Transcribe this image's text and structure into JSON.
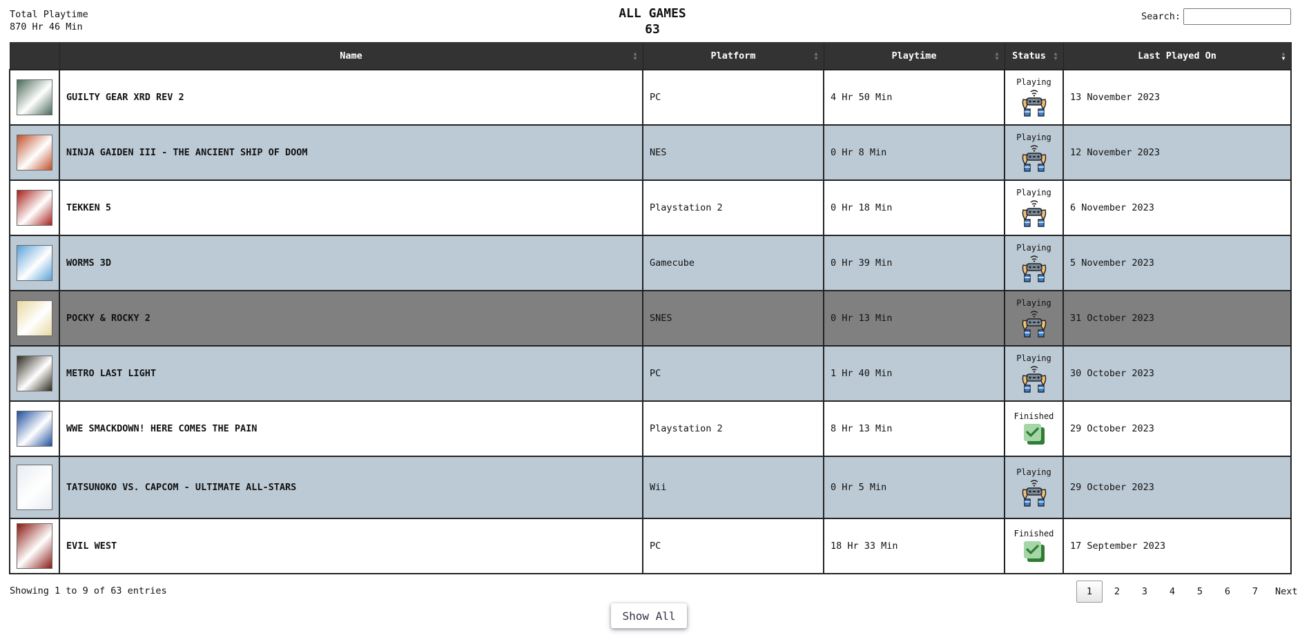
{
  "header": {
    "total_playtime_label": "Total Playtime",
    "total_playtime_value": "870 Hr 46 Min",
    "title": "ALL GAMES",
    "count": "63",
    "search_label": "Search:",
    "search_value": ""
  },
  "table": {
    "columns": [
      "Name",
      "Platform",
      "Playtime",
      "Status",
      "Last Played On"
    ],
    "rows": [
      {
        "name": "GUILTY GEAR XRD REV 2",
        "platform": "PC",
        "playtime": "4 Hr 50 Min",
        "status": "Playing",
        "last_played": "13 November 2023",
        "cover": "#4a6a5a"
      },
      {
        "name": "NINJA GAIDEN III - THE ANCIENT SHIP OF DOOM",
        "platform": "NES",
        "playtime": "0 Hr 8 Min",
        "status": "Playing",
        "last_played": "12 November 2023",
        "cover": "#c0502a"
      },
      {
        "name": "TEKKEN 5",
        "platform": "Playstation 2",
        "playtime": "0 Hr 18 Min",
        "status": "Playing",
        "last_played": "6 November 2023",
        "cover": "#a8201c"
      },
      {
        "name": "WORMS 3D",
        "platform": "Gamecube",
        "playtime": "0 Hr 39 Min",
        "status": "Playing",
        "last_played": "5 November 2023",
        "cover": "#5aa2d8"
      },
      {
        "name": "POCKY & ROCKY 2",
        "platform": "SNES",
        "playtime": "0 Hr 13 Min",
        "status": "Playing",
        "last_played": "31 October 2023",
        "cover": "#e8d8a0"
      },
      {
        "name": "METRO LAST LIGHT",
        "platform": "PC",
        "playtime": "1 Hr 40 Min",
        "status": "Playing",
        "last_played": "30 October 2023",
        "cover": "#2e2a1e"
      },
      {
        "name": "WWE SMACKDOWN! HERE COMES THE PAIN",
        "platform": "Playstation 2",
        "playtime": "8 Hr 13 Min",
        "status": "Finished",
        "last_played": "29 October 2023",
        "cover": "#1f4f9e"
      },
      {
        "name": "TATSUNOKO VS. CAPCOM - ULTIMATE ALL-STARS",
        "platform": "Wii",
        "playtime": "0 Hr 5 Min",
        "status": "Playing",
        "last_played": "29 October 2023",
        "cover": "#e8ecf2"
      },
      {
        "name": "EVIL WEST",
        "platform": "PC",
        "playtime": "18 Hr 33 Min",
        "status": "Finished",
        "last_played": "17 September 2023",
        "cover": "#8a1a12"
      }
    ]
  },
  "footer": {
    "entries_info": "Showing 1 to 9 of 63 entries",
    "pages": [
      "1",
      "2",
      "3",
      "4",
      "5",
      "6",
      "7"
    ],
    "current_page": "1",
    "next_label": "Next",
    "show_all_label": "Show All"
  },
  "colors": {
    "header_bg": "#333333",
    "row_odd": "#ffffff",
    "row_even": "#bccad5",
    "row_hover": "#808080",
    "finished_green": "#4caf50"
  },
  "icons": {
    "playing": "gamepad-hands-icon",
    "finished": "check-box-icon"
  }
}
